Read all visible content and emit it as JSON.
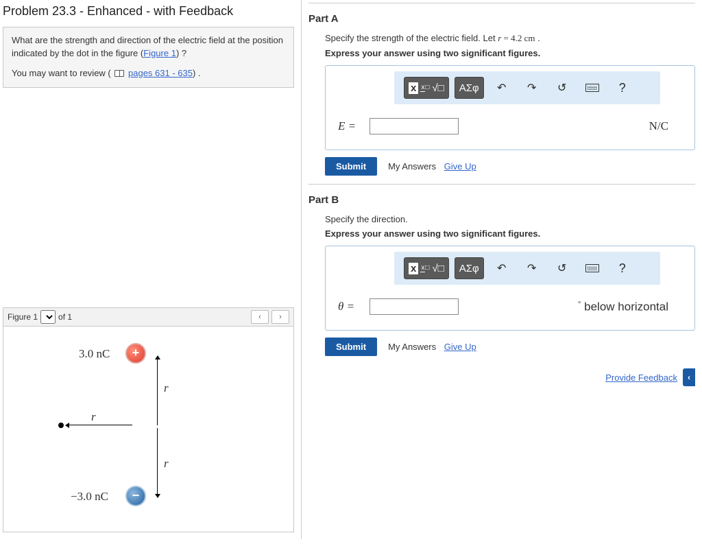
{
  "title": "Problem 23.3 - Enhanced - with Feedback",
  "prompt": {
    "line1_pre": "What are the strength and direction of the electric field at the position indicated by the dot in the figure (",
    "figure_link": "Figure 1",
    "line1_post": ") ?",
    "line2_pre": "You may want to review ( ",
    "pages_link": "pages 631 - 635",
    "line2_post": ") ."
  },
  "figure": {
    "label": "Figure 1",
    "of_text": " of 1",
    "pos_charge": "3.0 nC",
    "neg_charge": "−3.0 nC",
    "pos_sign": "+",
    "neg_sign": "−",
    "r": "r"
  },
  "partA": {
    "header": "Part A",
    "instr1_pre": "Specify the strength of the electric field. Let ",
    "instr1_var": "r",
    "instr1_eq": " = 4.2 cm",
    "instr1_post": " .",
    "instr2": "Express your answer using two significant figures.",
    "lhs": "E =",
    "unit": "N/C"
  },
  "partB": {
    "header": "Part B",
    "instr1": "Specify the direction.",
    "instr2": "Express your answer using two significant figures.",
    "lhs": "θ =",
    "unit_deg": "°",
    "unit_text": " below horizontal"
  },
  "toolbar": {
    "tmpl": "x",
    "frac_top": "x",
    "frac_bot": "□",
    "root": "√□",
    "greek": "ΑΣφ",
    "undo": "↶",
    "redo": "↷",
    "reset": "↺",
    "help": "?"
  },
  "buttons": {
    "submit": "Submit",
    "my_answers": "My Answers",
    "give_up": "Give Up",
    "provide_feedback": "Provide Feedback",
    "prev": "‹",
    "next": "›"
  }
}
